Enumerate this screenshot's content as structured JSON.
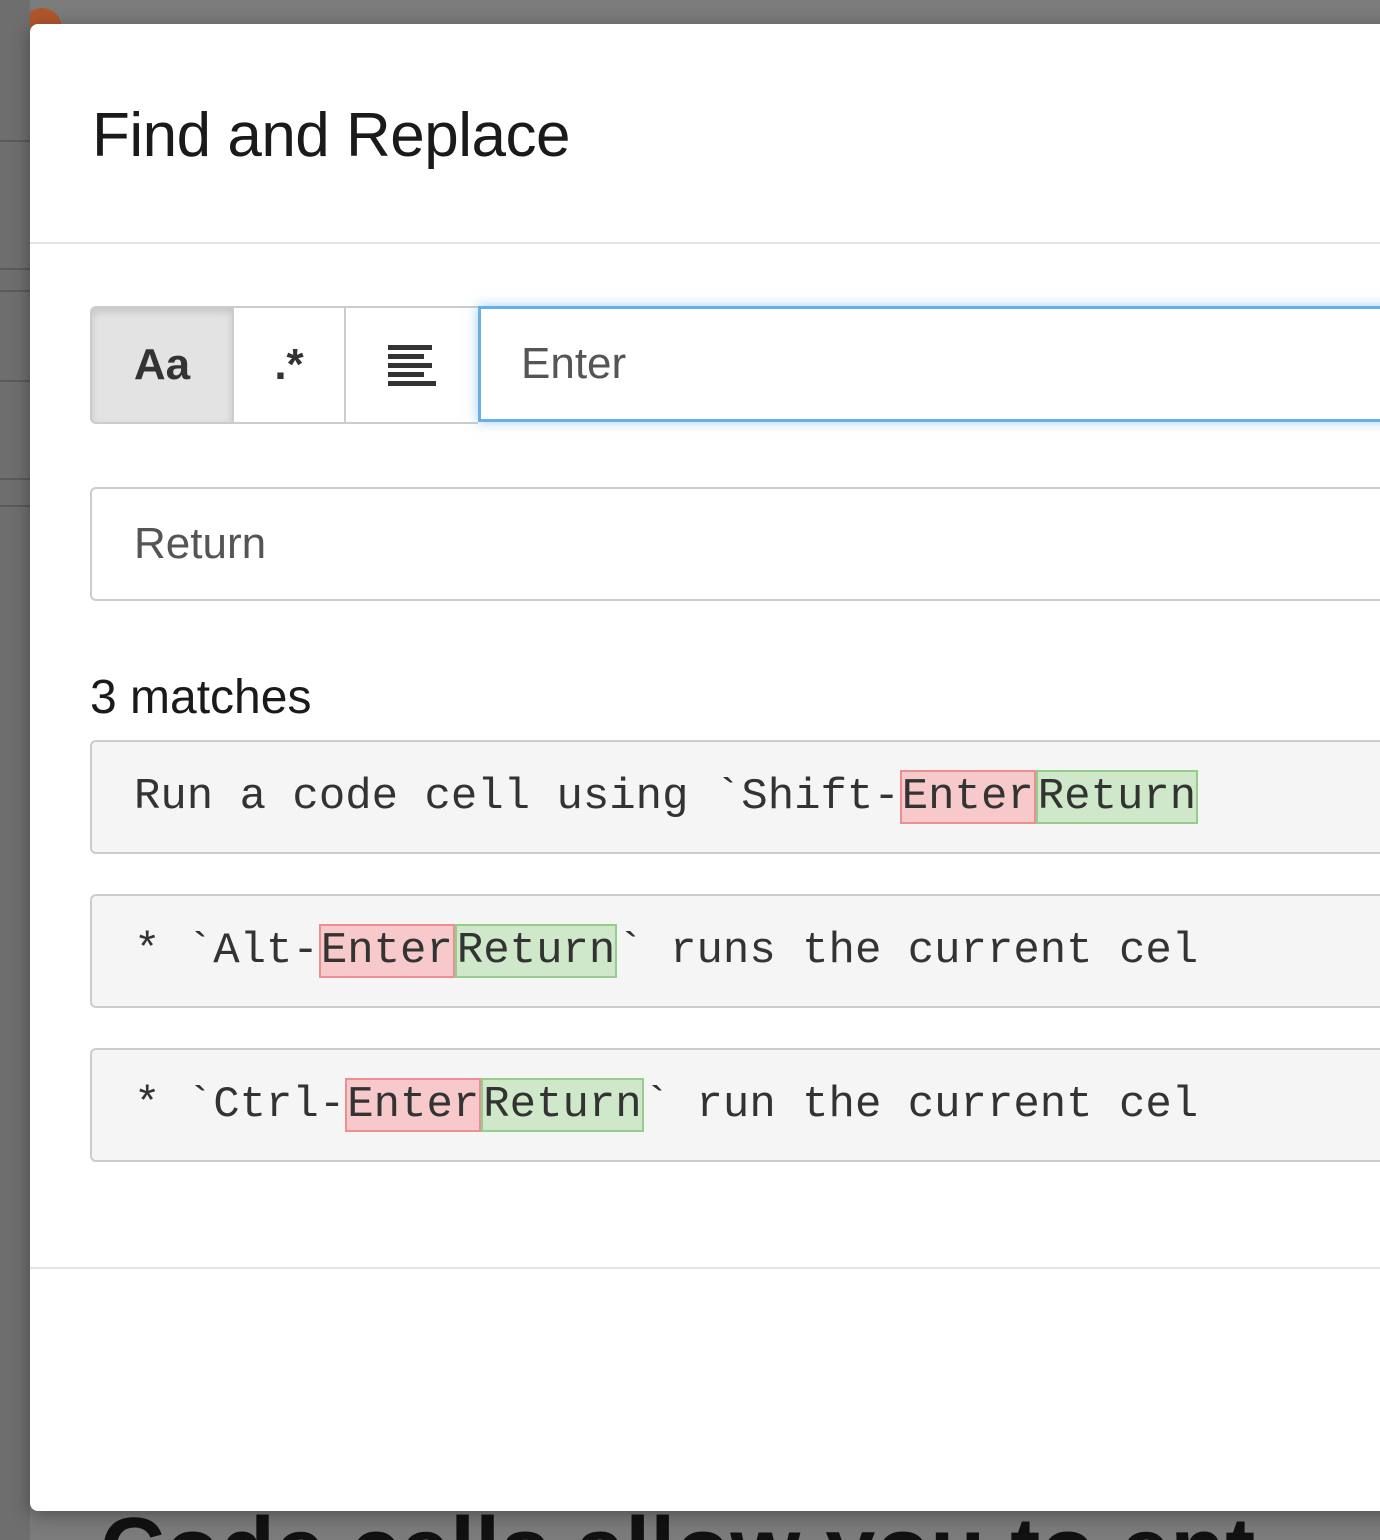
{
  "dialog": {
    "title": "Find and Replace"
  },
  "toggles": {
    "case_label": "Aa",
    "regex_label": ".*",
    "selection_icon": "align-left-icon",
    "case_active": true
  },
  "find": {
    "value": "Enter"
  },
  "replace": {
    "value": "Return"
  },
  "results": {
    "count_label": "3 matches",
    "items": [
      {
        "before": "Run a code cell using `Shift-",
        "match": "Enter",
        "replacement": "Return",
        "after": ""
      },
      {
        "before": "* `Alt-",
        "match": "Enter",
        "replacement": "Return",
        "after": "` runs the current cel"
      },
      {
        "before": "* `Ctrl-",
        "match": "Enter",
        "replacement": "Return",
        "after": "` run the current cel"
      }
    ]
  },
  "background": {
    "heading_text": "Code cells allow you to ent"
  },
  "colors": {
    "focus_border": "#66afe9",
    "match_highlight": "#f7c9cb",
    "replacement_highlight": "#cfe8c9"
  }
}
